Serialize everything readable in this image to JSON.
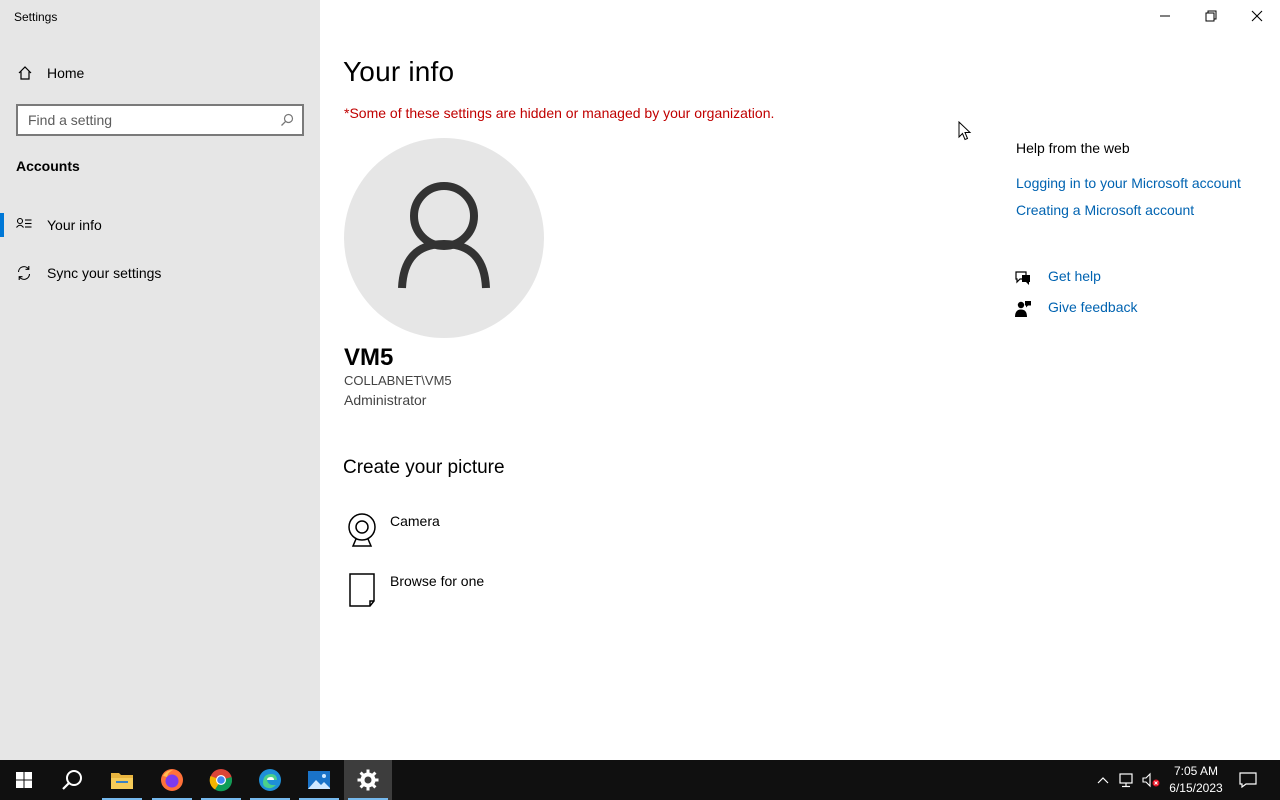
{
  "window": {
    "title": "Settings",
    "controls": {
      "minimize": "minimize-icon",
      "restore": "restore-icon",
      "close": "close-icon"
    }
  },
  "sidebar": {
    "home_label": "Home",
    "search_placeholder": "Find a setting",
    "section_title": "Accounts",
    "items": [
      {
        "label": "Your info",
        "icon": "person-list-icon",
        "selected": true
      },
      {
        "label": "Sync your settings",
        "icon": "sync-icon",
        "selected": false
      }
    ]
  },
  "main": {
    "title": "Your info",
    "org_note": "*Some of these settings are hidden or managed by your organization.",
    "user": {
      "name": "VM5",
      "domain": "COLLABNET\\VM5",
      "role": "Administrator"
    },
    "create_picture_title": "Create your picture",
    "picture_options": [
      {
        "label": "Camera",
        "icon": "camera-icon"
      },
      {
        "label": "Browse for one",
        "icon": "browse-file-icon"
      }
    ]
  },
  "help": {
    "title": "Help from the web",
    "links": [
      "Logging in to your Microsoft account",
      "Creating a Microsoft account"
    ],
    "actions": [
      {
        "label": "Get help",
        "icon": "get-help-icon"
      },
      {
        "label": "Give feedback",
        "icon": "feedback-icon"
      }
    ]
  },
  "taskbar": {
    "apps": [
      "start-icon",
      "search-icon",
      "file-explorer-icon",
      "firefox-icon",
      "chrome-icon",
      "edge-icon",
      "photos-icon",
      "settings-icon"
    ],
    "time": "7:05 AM",
    "date": "6/15/2023"
  },
  "colors": {
    "accent": "#0078d7",
    "link": "#0063b1",
    "warning_text": "#c00000",
    "sidebar_bg": "#e6e6e6",
    "taskbar_bg": "#101010"
  }
}
